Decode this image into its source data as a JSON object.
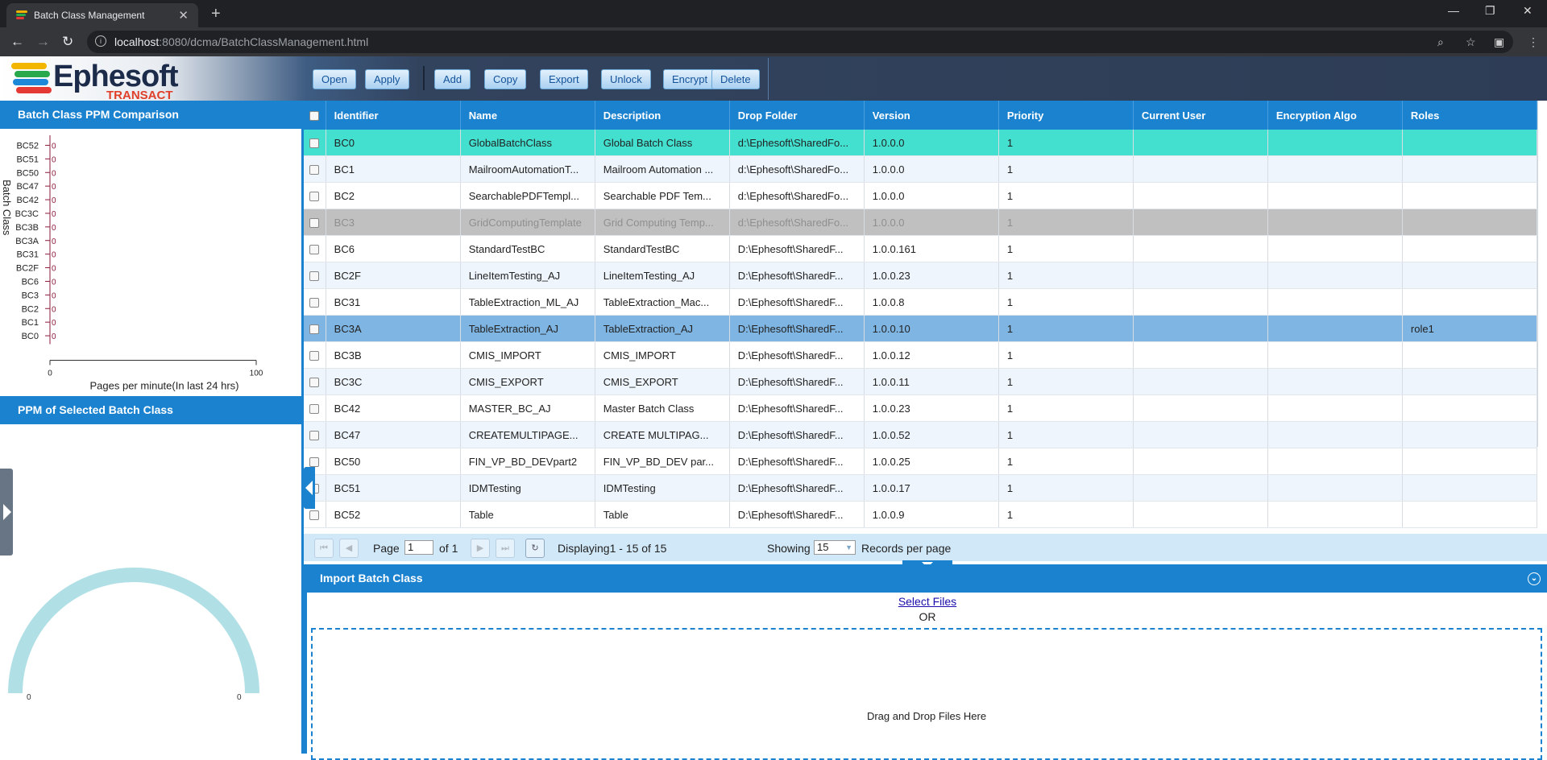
{
  "browser": {
    "tab_title": "Batch Class Management",
    "url_host": "localhost",
    "url_path": ":8080/dcma/BatchClassManagement.html"
  },
  "logo": {
    "word": "Ephesoft",
    "sub": "TRANSACT"
  },
  "toolbar": {
    "buttons": [
      "Open",
      "Apply",
      "Add",
      "Copy",
      "Export",
      "Unlock",
      "Encrypt",
      "Delete"
    ]
  },
  "left_panel": {
    "ppm_comparison_title": "Batch Class PPM Comparison",
    "selected_ppm_title": "PPM of Selected Batch Class",
    "gauge": {
      "min_label": "0",
      "max_label": "0",
      "value": 0
    }
  },
  "chart_data": {
    "type": "bar",
    "orientation": "horizontal",
    "categories": [
      "BC52",
      "BC51",
      "BC50",
      "BC47",
      "BC42",
      "BC3C",
      "BC3B",
      "BC3A",
      "BC31",
      "BC2F",
      "BC6",
      "BC3",
      "BC2",
      "BC1",
      "BC0"
    ],
    "values": [
      0,
      0,
      0,
      0,
      0,
      0,
      0,
      0,
      0,
      0,
      0,
      0,
      0,
      0,
      0
    ],
    "value_labels": [
      "0",
      "0",
      "0",
      "0",
      "0",
      "0",
      "0",
      "0",
      "0",
      "0",
      "0",
      "0",
      "0",
      "0",
      "0"
    ],
    "xlabel": "Pages per minute(In last 24 hrs)",
    "ylabel": "Batch Class",
    "xlim": [
      0,
      100
    ],
    "x_ticks": [
      "0",
      "100"
    ],
    "colors": {
      "axis": "#8b1a3a"
    }
  },
  "grid": {
    "columns": [
      "Identifier",
      "Name",
      "Description",
      "Drop Folder",
      "Version",
      "Priority",
      "Current User",
      "Encryption Algo",
      "Roles"
    ],
    "rows": [
      {
        "state": "green",
        "cells": [
          "BC0",
          "GlobalBatchClass",
          "Global Batch Class",
          "d:\\Ephesoft\\SharedFo...",
          "1.0.0.0",
          "1",
          "",
          "",
          ""
        ]
      },
      {
        "state": "alt",
        "cells": [
          "BC1",
          "MailroomAutomationT...",
          "Mailroom Automation ...",
          "d:\\Ephesoft\\SharedFo...",
          "1.0.0.0",
          "1",
          "",
          "",
          ""
        ]
      },
      {
        "state": "normal",
        "cells": [
          "BC2",
          "SearchablePDFTempl...",
          "Searchable PDF Tem...",
          "d:\\Ephesoft\\SharedFo...",
          "1.0.0.0",
          "1",
          "",
          "",
          ""
        ]
      },
      {
        "state": "disabled",
        "cells": [
          "BC3",
          "GridComputingTemplate",
          "Grid Computing Temp...",
          "d:\\Ephesoft\\SharedFo...",
          "1.0.0.0",
          "1",
          "",
          "",
          ""
        ]
      },
      {
        "state": "normal",
        "cells": [
          "BC6",
          "StandardTestBC",
          "StandardTestBC",
          "D:\\Ephesoft\\SharedF...",
          "1.0.0.161",
          "1",
          "",
          "",
          ""
        ]
      },
      {
        "state": "alt",
        "cells": [
          "BC2F",
          "LineItemTesting_AJ",
          "LineItemTesting_AJ",
          "D:\\Ephesoft\\SharedF...",
          "1.0.0.23",
          "1",
          "",
          "",
          ""
        ]
      },
      {
        "state": "normal",
        "cells": [
          "BC31",
          "TableExtraction_ML_AJ",
          "TableExtraction_Mac...",
          "D:\\Ephesoft\\SharedF...",
          "1.0.0.8",
          "1",
          "",
          "",
          ""
        ]
      },
      {
        "state": "selected",
        "cells": [
          "BC3A",
          "TableExtraction_AJ",
          "TableExtraction_AJ",
          "D:\\Ephesoft\\SharedF...",
          "1.0.0.10",
          "1",
          "",
          "",
          "role1"
        ]
      },
      {
        "state": "normal",
        "cells": [
          "BC3B",
          "CMIS_IMPORT",
          "CMIS_IMPORT",
          "D:\\Ephesoft\\SharedF...",
          "1.0.0.12",
          "1",
          "",
          "",
          ""
        ]
      },
      {
        "state": "alt",
        "cells": [
          "BC3C",
          "CMIS_EXPORT",
          "CMIS_EXPORT",
          "D:\\Ephesoft\\SharedF...",
          "1.0.0.11",
          "1",
          "",
          "",
          ""
        ]
      },
      {
        "state": "normal",
        "cells": [
          "BC42",
          "MASTER_BC_AJ",
          "Master Batch Class",
          "D:\\Ephesoft\\SharedF...",
          "1.0.0.23",
          "1",
          "",
          "",
          ""
        ]
      },
      {
        "state": "alt",
        "cells": [
          "BC47",
          "CREATEMULTIPAGE...",
          "CREATE MULTIPAG...",
          "D:\\Ephesoft\\SharedF...",
          "1.0.0.52",
          "1",
          "",
          "",
          ""
        ]
      },
      {
        "state": "normal",
        "cells": [
          "BC50",
          "FIN_VP_BD_DEVpart2",
          "FIN_VP_BD_DEV par...",
          "D:\\Ephesoft\\SharedF...",
          "1.0.0.25",
          "1",
          "",
          "",
          ""
        ]
      },
      {
        "state": "alt",
        "cells": [
          "BC51",
          "IDMTesting",
          "IDMTesting",
          "D:\\Ephesoft\\SharedF...",
          "1.0.0.17",
          "1",
          "",
          "",
          ""
        ]
      },
      {
        "state": "normal",
        "cells": [
          "BC52",
          "Table",
          "Table",
          "D:\\Ephesoft\\SharedF...",
          "1.0.0.9",
          "1",
          "",
          "",
          ""
        ]
      }
    ]
  },
  "paging": {
    "page_label": "Page",
    "page_value": "1",
    "of_label": "of 1",
    "displaying": "Displaying1 - 15 of 15",
    "showing_label": "Showing",
    "per_page_value": "15",
    "records_label": "Records per page"
  },
  "import": {
    "title": "Import Batch Class",
    "select_files": "Select Files",
    "or_text": "OR",
    "drop_text": "Drag and Drop Files Here"
  },
  "colors": {
    "header_blue": "#1b82cf",
    "row_green": "#43e0d0",
    "row_selected": "#7fb5e2",
    "row_disabled": "#c0c0c0",
    "gauge": "#b0e0e6"
  }
}
